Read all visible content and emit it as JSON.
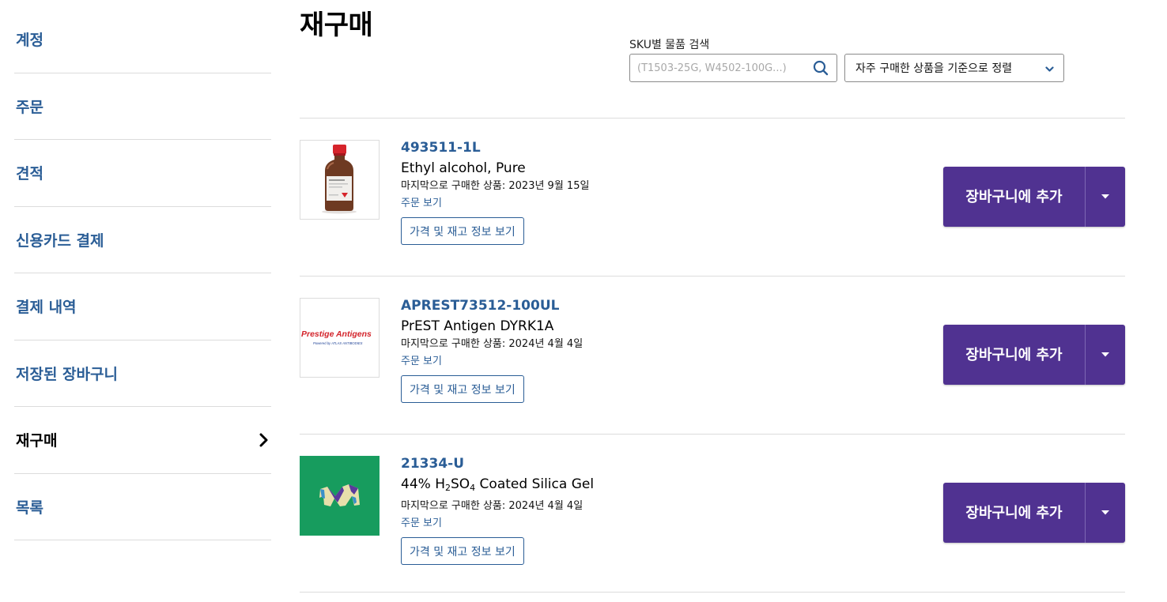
{
  "sidebar": {
    "items": [
      {
        "label": "계정"
      },
      {
        "label": "주문"
      },
      {
        "label": "견적"
      },
      {
        "label": "신용카드 결제"
      },
      {
        "label": "결제 내역"
      },
      {
        "label": "저장된 장바구니"
      },
      {
        "label": "재구매",
        "active": true
      },
      {
        "label": "목록"
      }
    ]
  },
  "page": {
    "title": "재구매"
  },
  "search": {
    "label": "SKU별 물품 검색",
    "placeholder": "(T1503-25G, W4502-100G...)",
    "icon": "search-icon"
  },
  "sort": {
    "selected": "자주 구매한 상품을 기준으로 정렬",
    "icon": "chevron-down-icon"
  },
  "colors": {
    "link": "#2a5d96",
    "cart_button": "#503291",
    "divider": "#dcdcdc"
  },
  "products": [
    {
      "sku": "493511-1L",
      "name": "Ethyl alcohol, Pure",
      "last_purchased": "마지막으로 구매한 상품: 2023년 9월 15일",
      "view_order": "주문 보기",
      "price_button": "가격 및 재고 정보 보기",
      "cart_button": "장바구니에 추가",
      "image": "brown-bottle-red-cap"
    },
    {
      "sku": "APREST73512-100UL",
      "name": "PrEST Antigen DYRK1A",
      "last_purchased": "마지막으로 구매한 상품: 2024년 4월 4일",
      "view_order": "주문 보기",
      "price_button": "가격 및 재고 정보 보기",
      "cart_button": "장바구니에 추가",
      "image": "prestige-antigens-logo",
      "logo_text": "Prestige Antigens",
      "logo_subtext": "Powered by ATLAS ANTIBODIES"
    },
    {
      "sku": "21334-U",
      "name_parts": [
        "44% H",
        "2",
        "SO",
        "4",
        " Coated Silica Gel"
      ],
      "last_purchased": "마지막으로 구매한 상품: 2024년 4월 4일",
      "view_order": "주문 보기",
      "price_button": "가격 및 재고 정보 보기",
      "cart_button": "장바구니에 추가",
      "image": "merck-m-logo-green"
    }
  ]
}
